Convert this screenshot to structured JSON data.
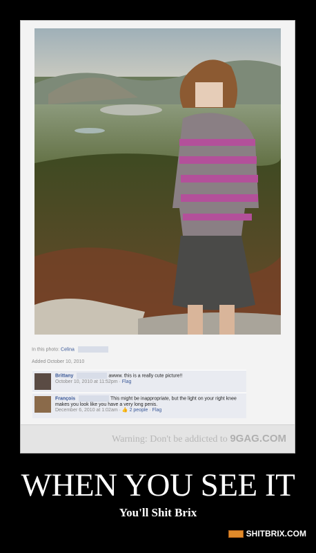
{
  "poster": {
    "headline": "WHEN YOU SEE IT",
    "subline": "You'll Shit Brix",
    "logo_text": "SHITBRIX.COM"
  },
  "facebook_photo": {
    "in_photo_label": "In this photo:",
    "tagged_name": "Celina",
    "added_label": "Added October 10, 2010"
  },
  "comments": [
    {
      "author": "Brittany",
      "text": "awww. this is a really cute picture!!",
      "timestamp": "October 10, 2010 at 11:52pm",
      "links": [
        "Flag"
      ]
    },
    {
      "author": "François",
      "text": "This might be inappropriate, but the light on your right knee makes you look like you have a very long penis.",
      "timestamp": "December 6, 2010 at 1:02am",
      "likes": "2 people",
      "links": [
        "Flag"
      ]
    }
  ],
  "warning": {
    "text": "Warning: Don't be addicted to",
    "brand": "9GAG.COM"
  }
}
